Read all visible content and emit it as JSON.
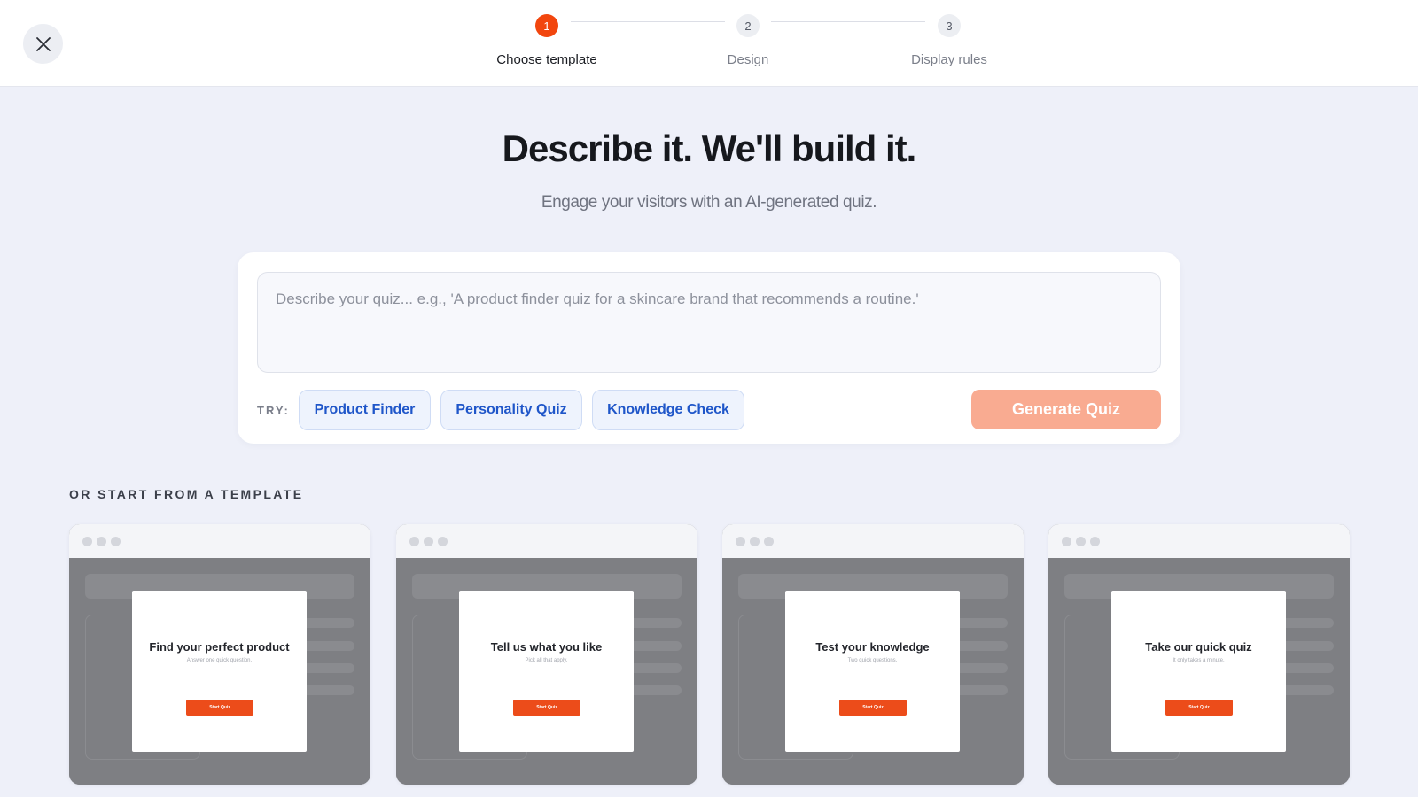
{
  "header": {
    "close_icon": "close-icon",
    "steps": [
      {
        "number": "1",
        "label": "Choose template",
        "state": "active"
      },
      {
        "number": "2",
        "label": "Design",
        "state": "inactive"
      },
      {
        "number": "3",
        "label": "Display rules",
        "state": "inactive"
      }
    ]
  },
  "hero": {
    "title": "Describe it. We'll build it.",
    "subtitle": "Engage your visitors with an AI-generated quiz."
  },
  "prompt": {
    "value": "",
    "placeholder": "Describe your quiz... e.g., 'A product finder quiz for a skincare brand that recommends a routine.'",
    "try_label": "TRY:",
    "chips": [
      "Product Finder",
      "Personality Quiz",
      "Knowledge Check"
    ],
    "generate_label": "Generate Quiz"
  },
  "templates": {
    "heading": "OR START FROM A TEMPLATE",
    "items": [
      {
        "title": "Find your perfect product",
        "subtitle": "Answer one quick question.",
        "button": "Start Quiz"
      },
      {
        "title": "Tell us what you like",
        "subtitle": "Pick all that apply.",
        "button": "Start Quiz"
      },
      {
        "title": "Test your knowledge",
        "subtitle": "Two quick questions.",
        "button": "Start Quiz"
      },
      {
        "title": "Take our quick quiz",
        "subtitle": "It only takes a minute.",
        "button": "Start Quiz"
      }
    ]
  },
  "colors": {
    "accent": "#f2460e",
    "generate_disabled": "#f9ab91",
    "chip_text": "#1f56c9",
    "page_background": "#eef0f9"
  }
}
